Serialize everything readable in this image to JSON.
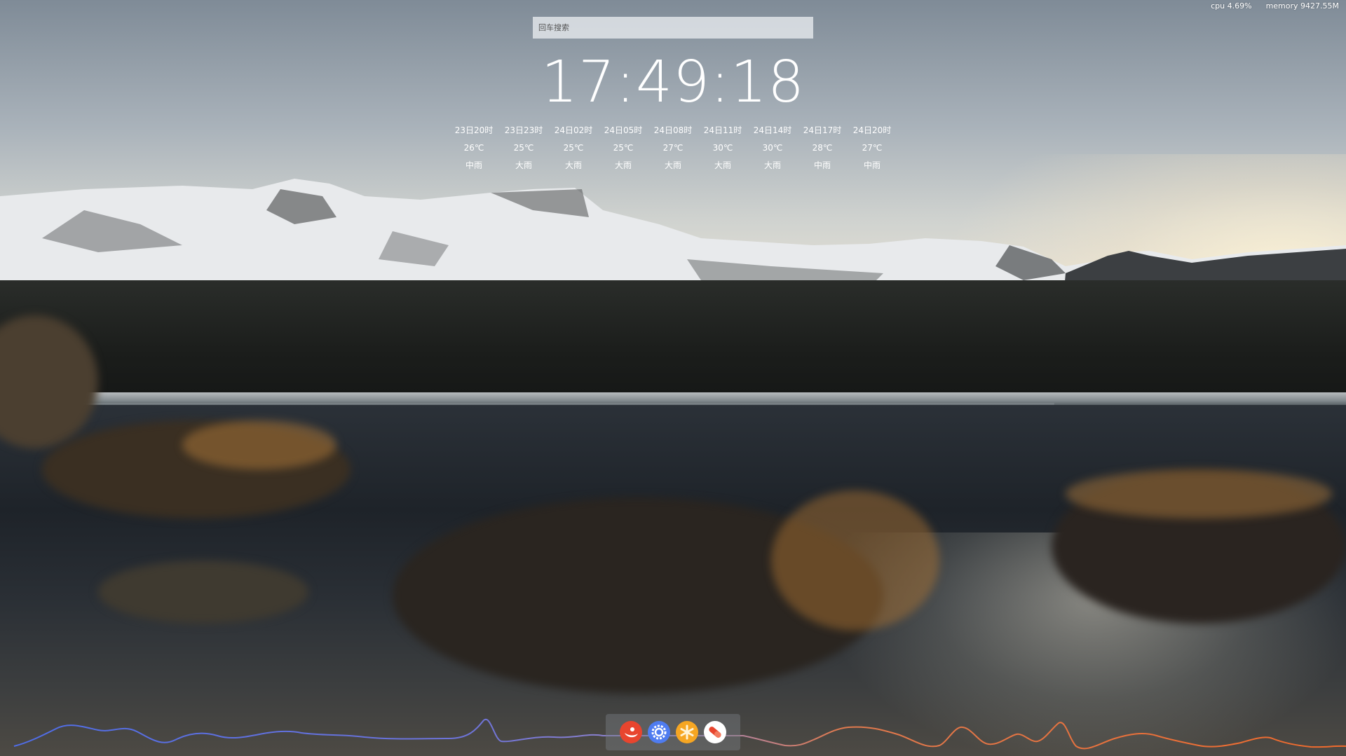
{
  "system_stats": {
    "cpu": "cpu 4.69%",
    "memory": "memory 9427.55M"
  },
  "search": {
    "placeholder": "回车搜索"
  },
  "clock": {
    "time": "17:49:18"
  },
  "weather": [
    {
      "time": "23日20时",
      "temp": "26℃",
      "condition": "中雨"
    },
    {
      "time": "23日23时",
      "temp": "25℃",
      "condition": "大雨"
    },
    {
      "time": "24日02时",
      "temp": "25℃",
      "condition": "大雨"
    },
    {
      "time": "24日05时",
      "temp": "25℃",
      "condition": "大雨"
    },
    {
      "time": "24日08时",
      "temp": "27℃",
      "condition": "大雨"
    },
    {
      "time": "24日11时",
      "temp": "30℃",
      "condition": "大雨"
    },
    {
      "time": "24日14时",
      "temp": "30℃",
      "condition": "大雨"
    },
    {
      "time": "24日17时",
      "temp": "28℃",
      "condition": "中雨"
    },
    {
      "time": "24日20时",
      "temp": "27℃",
      "condition": "中雨"
    }
  ],
  "dock": {
    "apps": [
      {
        "icon": "camera-app-icon",
        "color": "#e8452e"
      },
      {
        "icon": "settings-gear-icon",
        "color": "#4f7cf0"
      },
      {
        "icon": "asterisk-app-icon",
        "color": "#f6a623"
      },
      {
        "icon": "pill-app-icon",
        "color": "#e8452e"
      }
    ]
  },
  "visualizer": {
    "colors": [
      "#4f6de8",
      "#8a7fd8",
      "#e0744a",
      "#f06a2c"
    ]
  }
}
